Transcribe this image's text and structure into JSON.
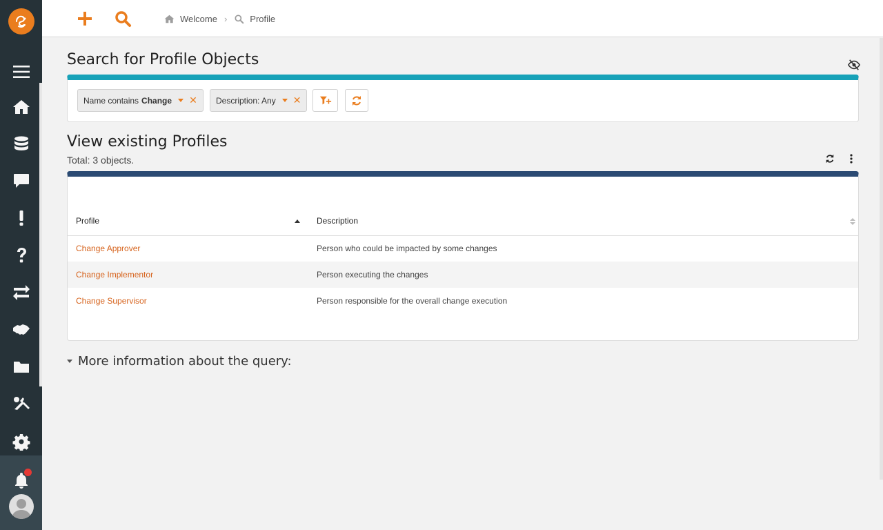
{
  "sidebar": {
    "logo_icon": "app-logo-icon",
    "items": [
      {
        "name": "menu",
        "icon": "hamburger-icon"
      },
      {
        "name": "welcome",
        "icon": "home-icon"
      },
      {
        "name": "configuration-management",
        "icon": "database-icon"
      },
      {
        "name": "helpdesk",
        "icon": "chat-icon"
      },
      {
        "name": "incident-management",
        "icon": "exclamation-icon"
      },
      {
        "name": "problem-management",
        "icon": "question-icon"
      },
      {
        "name": "change-management",
        "icon": "arrows-exchange-icon"
      },
      {
        "name": "service-management",
        "icon": "handshake-icon"
      },
      {
        "name": "data-administration",
        "icon": "folder-icon"
      },
      {
        "name": "admin-tools",
        "icon": "tools-icon"
      },
      {
        "name": "system",
        "icon": "gear-icon"
      }
    ],
    "notifications_icon": "bell-icon",
    "notification_badge_color": "#e53935"
  },
  "topbar": {
    "new_icon": "plus-icon",
    "search_icon": "search-icon",
    "breadcrumb": [
      {
        "label": "Welcome",
        "icon": "home-icon"
      },
      {
        "label": "Profile",
        "icon": "search-icon"
      }
    ]
  },
  "search": {
    "title": "Search for Profile Objects",
    "criteria": [
      {
        "prefix": "Name contains",
        "value": "Change"
      },
      {
        "prefix": "Description: Any",
        "value": ""
      }
    ],
    "add_criterion_icon": "filter-plus-icon",
    "refresh_icon": "refresh-icon",
    "hide_icon": "eye-slash-icon"
  },
  "results": {
    "title": "View existing Profiles",
    "total": "Total: 3 objects.",
    "columns": [
      "Profile",
      "Description"
    ],
    "rows": [
      {
        "profile": "Change Approver",
        "description": "Person who could be impacted by some changes"
      },
      {
        "profile": "Change Implementor",
        "description": "Person executing the changes"
      },
      {
        "profile": "Change Supervisor",
        "description": "Person responsible for the overall change execution"
      }
    ]
  },
  "more_info": "More information about the query:",
  "colors": {
    "accent": "#ea7d1e",
    "search_panel_bar": "#17a2b8",
    "results_panel_bar": "#2b4a73",
    "sidebar_bg": "#263238"
  }
}
